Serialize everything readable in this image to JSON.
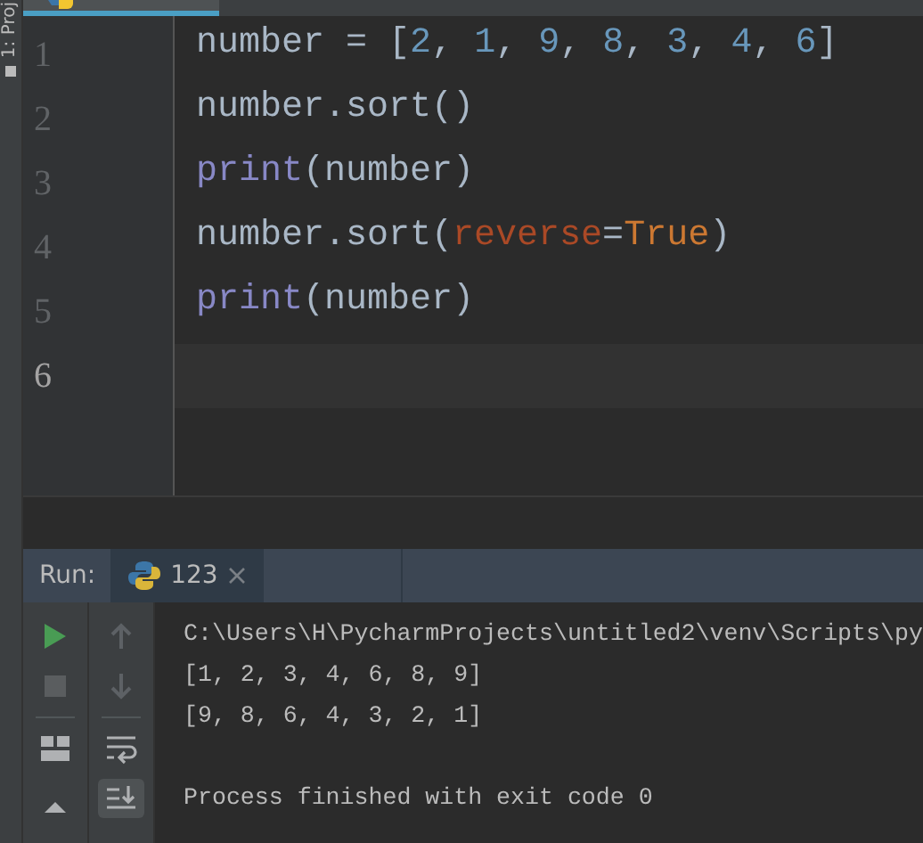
{
  "side_stripe": {
    "label": "1: Proj"
  },
  "editor": {
    "lines": [
      {
        "number": "1",
        "current": false,
        "tokens": [
          {
            "text": "number = ",
            "kind": "plain"
          },
          {
            "text": "[",
            "kind": "plain"
          },
          {
            "text": "2",
            "kind": "number"
          },
          {
            "text": ", ",
            "kind": "plain"
          },
          {
            "text": "1",
            "kind": "number"
          },
          {
            "text": ", ",
            "kind": "plain"
          },
          {
            "text": "9",
            "kind": "number"
          },
          {
            "text": ", ",
            "kind": "plain"
          },
          {
            "text": "8",
            "kind": "number"
          },
          {
            "text": ", ",
            "kind": "plain"
          },
          {
            "text": "3",
            "kind": "number"
          },
          {
            "text": ", ",
            "kind": "plain"
          },
          {
            "text": "4",
            "kind": "number"
          },
          {
            "text": ", ",
            "kind": "plain"
          },
          {
            "text": "6",
            "kind": "number"
          },
          {
            "text": "]",
            "kind": "plain"
          }
        ]
      },
      {
        "number": "2",
        "current": false,
        "tokens": [
          {
            "text": "number.sort()",
            "kind": "plain"
          }
        ]
      },
      {
        "number": "3",
        "current": false,
        "tokens": [
          {
            "text": "print",
            "kind": "builtin"
          },
          {
            "text": "(number)",
            "kind": "plain"
          }
        ]
      },
      {
        "number": "4",
        "current": false,
        "tokens": [
          {
            "text": "number.sort(",
            "kind": "plain"
          },
          {
            "text": "reverse",
            "kind": "param"
          },
          {
            "text": "=",
            "kind": "plain"
          },
          {
            "text": "True",
            "kind": "keyword"
          },
          {
            "text": ")",
            "kind": "plain"
          }
        ]
      },
      {
        "number": "5",
        "current": false,
        "tokens": [
          {
            "text": "print",
            "kind": "builtin"
          },
          {
            "text": "(number)",
            "kind": "plain"
          }
        ]
      },
      {
        "number": "6",
        "current": true
      }
    ]
  },
  "run_panel": {
    "label": "Run:",
    "tabs": [
      {
        "label": "123",
        "selected": true
      }
    ],
    "left_toolbar": [
      {
        "kind": "run"
      },
      {
        "kind": "stop"
      },
      {
        "kind": "layout"
      },
      {
        "kind": "pin"
      }
    ],
    "right_toolbar": [
      {
        "kind": "up",
        "on": false
      },
      {
        "kind": "down",
        "on": false
      },
      {
        "kind": "wrap",
        "on": false
      },
      {
        "kind": "scroll-end",
        "on": true
      }
    ],
    "output": [
      {
        "text": "C:\\Users\\H\\PycharmProjects\\untitled2\\venv\\Scripts\\py",
        "kind": "command"
      },
      {
        "text": "[1, 2, 3, 4, 6, 8, 9]",
        "kind": "stdout"
      },
      {
        "text": "[9, 8, 6, 4, 3, 2, 1]",
        "kind": "stdout"
      },
      {
        "text": "Process finished with exit code 0",
        "kind": "status"
      }
    ]
  }
}
